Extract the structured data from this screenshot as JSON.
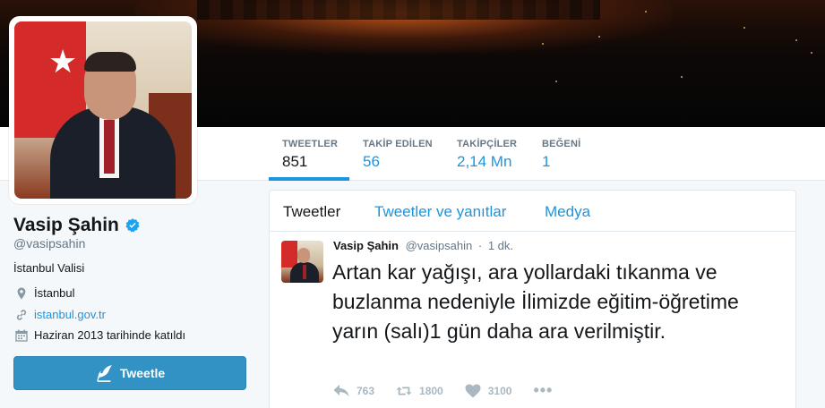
{
  "profile": {
    "name": "Vasip Şahin",
    "handle": "@vasipsahin",
    "bio": "İstanbul Valisi",
    "location": "İstanbul",
    "url": "istanbul.gov.tr",
    "joined": "Haziran 2013 tarihinde katıldı",
    "verified": true
  },
  "tweet_button": {
    "label": "Tweetle",
    "icon": "quill-icon"
  },
  "stats": [
    {
      "label": "TWEETLER",
      "value": "851",
      "active": true
    },
    {
      "label": "TAKİP EDİLEN",
      "value": "56",
      "active": false
    },
    {
      "label": "TAKİPÇİLER",
      "value": "2,14 Mn",
      "active": false
    },
    {
      "label": "BEĞENİ",
      "value": "1",
      "active": false
    }
  ],
  "timeline_tabs": [
    {
      "label": "Tweetler",
      "active": true
    },
    {
      "label": "Tweetler ve yanıtlar",
      "active": false
    },
    {
      "label": "Medya",
      "active": false
    }
  ],
  "tweet": {
    "author": "Vasip Şahin",
    "handle": "@vasipsahin",
    "separator": "·",
    "time": "1 dk.",
    "text": "Artan kar yağışı, ara yollardaki tıkanma ve buzlanma nedeniyle İlimizde eğitim-öğretime yarın (salı)1 gün daha ara verilmiştir.",
    "replies": "763",
    "retweets": "1800",
    "likes": "3100",
    "more": "•••"
  },
  "colors": {
    "accent": "#1b95e0",
    "tweet_button": "#3292c4",
    "verified": "#1da1f2",
    "muted": "#657786",
    "action_gray": "#aab8c2"
  }
}
